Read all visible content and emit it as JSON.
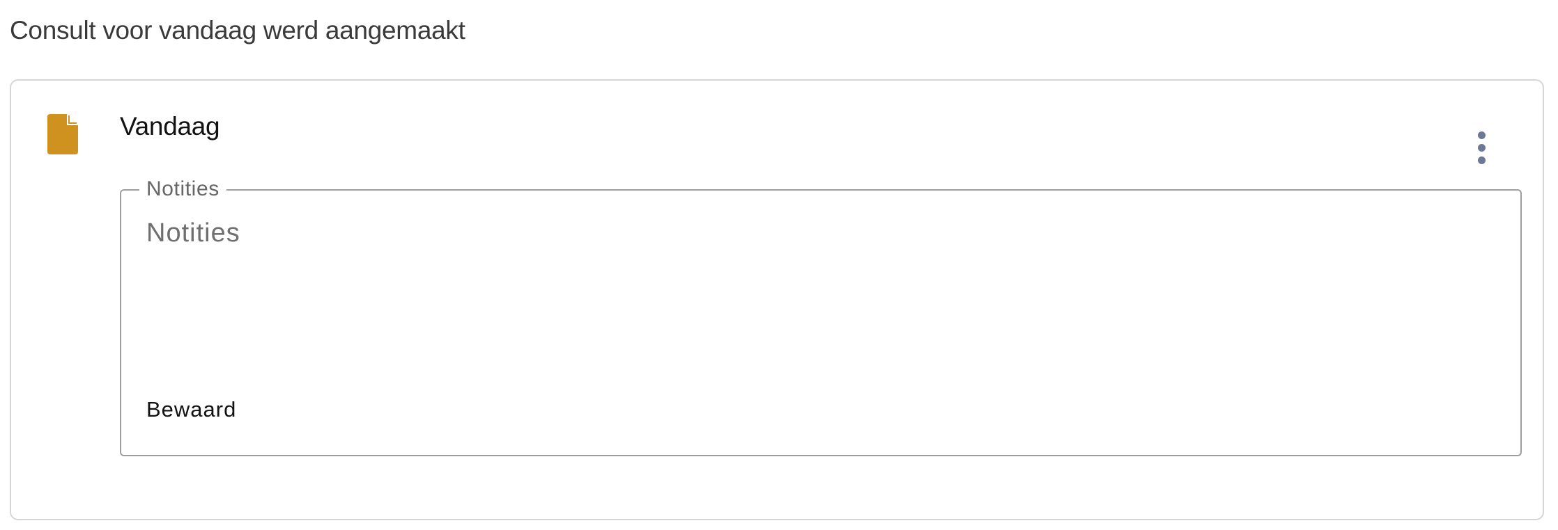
{
  "page": {
    "heading": "Consult voor vandaag werd aangemaakt"
  },
  "consult_card": {
    "title": "Vandaag",
    "icon": "file-icon",
    "icon_color": "#cf921e",
    "more_menu_icon": "more-vertical-icon",
    "notes": {
      "legend": "Notities",
      "placeholder": "Notities",
      "value": "",
      "status": "Bewaard"
    }
  }
}
